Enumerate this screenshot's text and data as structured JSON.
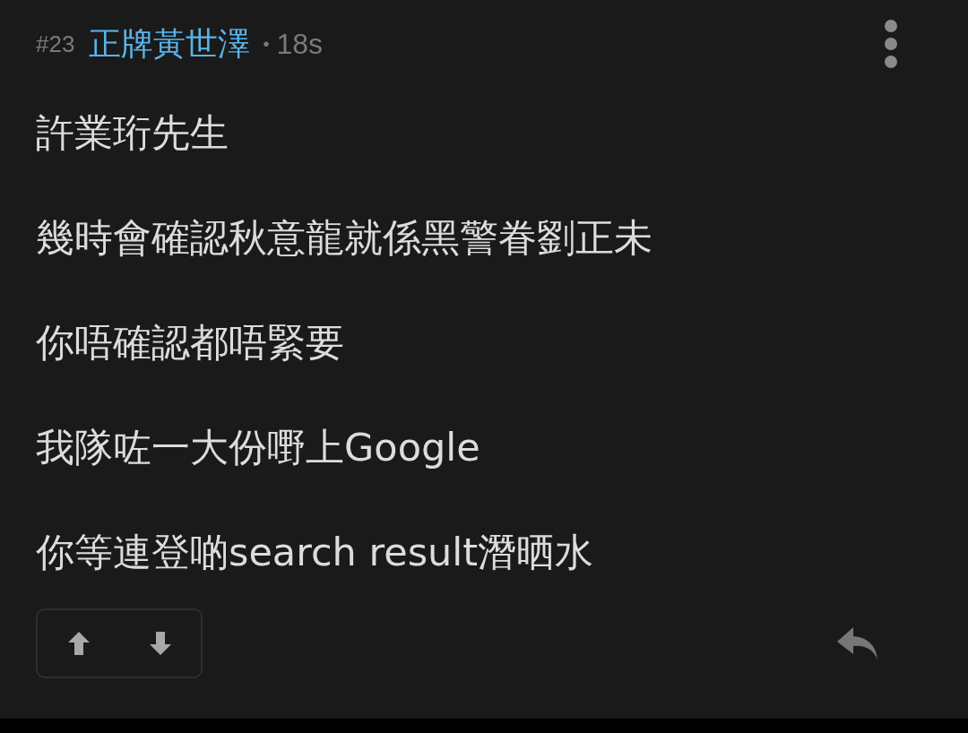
{
  "post": {
    "number": "#23",
    "author": "正牌黃世澤",
    "separator": "•",
    "time": "18s"
  },
  "lines": [
    "許業珩先生",
    "幾時會確認秋意龍就係黑警眷劉正未",
    "你唔確認都唔緊要",
    "我隊咗一大份嘢上Google",
    "你等連登啲search result潛晒水"
  ]
}
